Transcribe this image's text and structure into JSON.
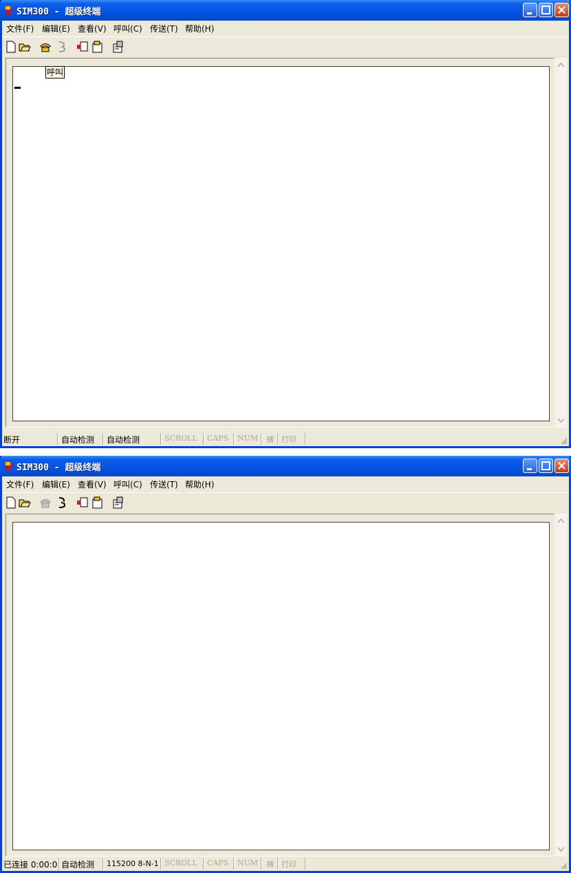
{
  "window1": {
    "title": "SIM300 - 超级终端",
    "menu": [
      "文件(F)",
      "编辑(E)",
      "查看(V)",
      "呼叫(C)",
      "传送(T)",
      "帮助(H)"
    ],
    "tooltip": "呼叫",
    "status": {
      "connection": "断开",
      "detect1": "自动检测",
      "detect2": "自动检测",
      "scroll": "SCROLL",
      "caps": "CAPS",
      "num": "NUM",
      "capture": "捕",
      "print": "打印"
    }
  },
  "window2": {
    "title": "SIM300 - 超级终端",
    "menu": [
      "文件(F)",
      "编辑(E)",
      "查看(V)",
      "呼叫(C)",
      "传送(T)",
      "帮助(H)"
    ],
    "status": {
      "connection": "已连接 0:00:0",
      "detect1": "自动检测",
      "baud": "115200 8-N-1",
      "scroll": "SCROLL",
      "caps": "CAPS",
      "num": "NUM",
      "capture": "捕",
      "print": "打印"
    }
  },
  "colors": {
    "titlebar": "#0454e4",
    "chrome": "#ece9d8",
    "close": "#c43c14"
  }
}
